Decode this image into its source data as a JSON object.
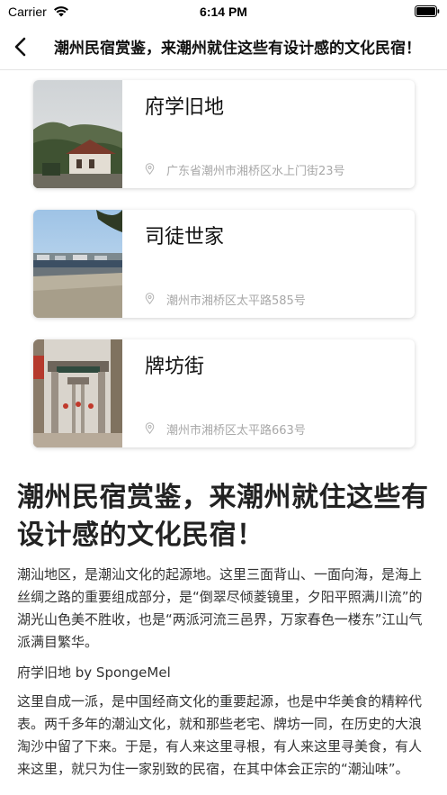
{
  "status_bar": {
    "carrier": "Carrier",
    "time": "6:14 PM"
  },
  "nav": {
    "title": "潮州民宿赏鉴，来潮州就住这些有设计感的文化民宿！",
    "back_icon": "chevron-left-icon"
  },
  "cards": [
    {
      "title": "府学旧地",
      "address": "广东省潮州市湘桥区水上门街23号",
      "image": "hillside-town-photo"
    },
    {
      "title": "司徒世家",
      "address": "潮州市湘桥区太平路585号",
      "image": "harbor-boats-photo"
    },
    {
      "title": "牌坊街",
      "address": "潮州市湘桥区太平路663号",
      "image": "memorial-archway-street-photo"
    }
  ],
  "article": {
    "title": "潮州民宿赏鉴，来潮州就住这些有设计感的文化民宿！",
    "paragraph1": "潮汕地区，是潮汕文化的起源地。这里三面背山、一面向海，是海上丝绸之路的重要组成部分，是“倒翠尽倾菱镜里，夕阳平照满川流”的湖光山色美不胜收，也是“两派河流三邑界，万家春色一楼东”江山气派满目繁华。",
    "caption": "府学旧地 by SpongeMel",
    "paragraph2": "这里自成一派，是中国经商文化的重要起源，也是中华美食的精粹代表。两千多年的潮汕文化，就和那些老宅、牌坊一同，在历史的大浪淘沙中留了下来。于是，有人来这里寻根，有人来这里寻美食，有人来这里，就只为住一家别致的民宿，在其中体会正宗的“潮汕味”。"
  },
  "colors": {
    "address_gray": "#a8a8a8",
    "divider": "#e4e4e4",
    "text_dark": "#222222"
  }
}
